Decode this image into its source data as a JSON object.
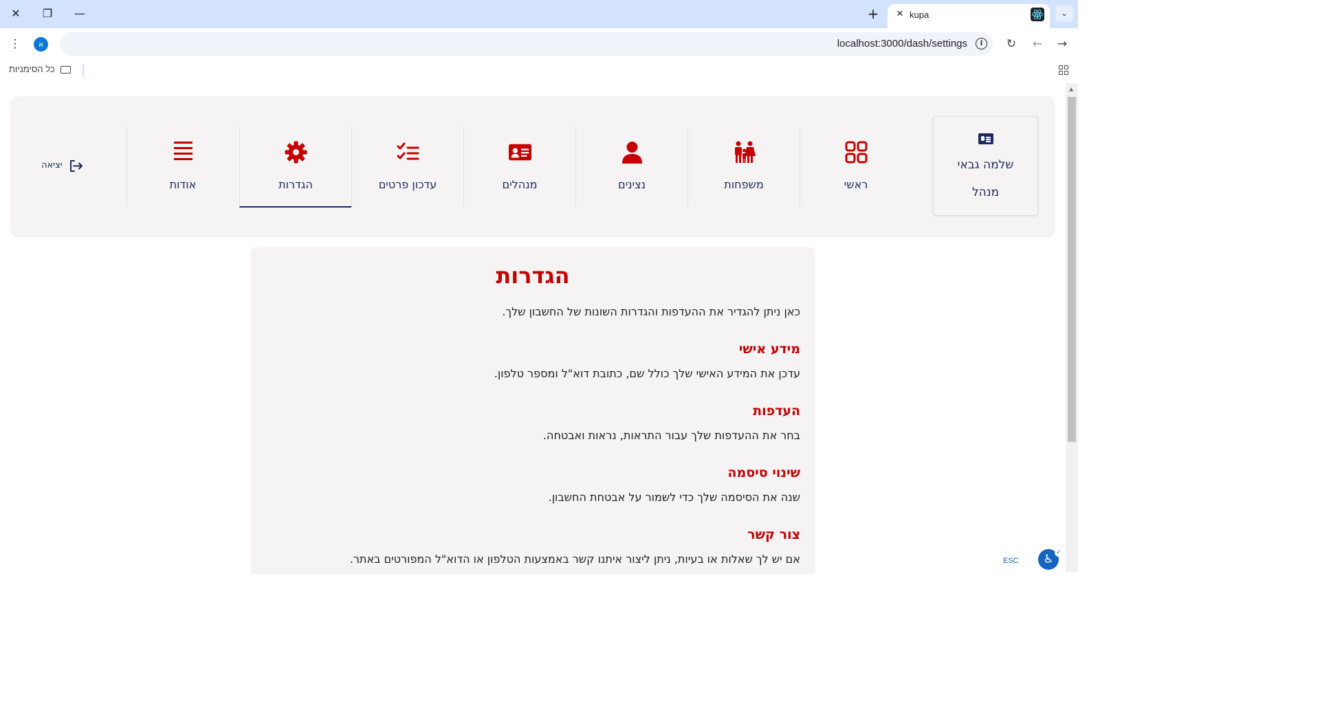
{
  "browser": {
    "tab_title": "kupa",
    "url": "localhost:3000/dash/settings",
    "profile_initial": "א",
    "bookmarks_all": "כל הסימניות",
    "new_tab": "+",
    "tab_list": "⌄"
  },
  "nav": {
    "user": {
      "name": "שלמה גבאי",
      "role": "מנהל"
    },
    "items": [
      {
        "label": "ראשי",
        "icon": "grid-icon"
      },
      {
        "label": "משפחות",
        "icon": "family-icon"
      },
      {
        "label": "נצינים",
        "icon": "person-icon"
      },
      {
        "label": "מנהלים",
        "icon": "id-card-icon"
      },
      {
        "label": "עדכון פרטים",
        "icon": "checklist-icon"
      },
      {
        "label": "הגדרות",
        "icon": "gear-icon",
        "active": true
      },
      {
        "label": "אודות",
        "icon": "menu-lines-icon"
      }
    ],
    "logout": "יציאה"
  },
  "colors": {
    "accent": "#c40000",
    "navy": "#1b2a5a",
    "panel": "#f5f3f4"
  },
  "content": {
    "title": "הגדרות",
    "intro": "כאן ניתן להגדיר את ההעדפות והגדרות השונות של החשבון שלך.",
    "sections": [
      {
        "title": "מידע אישי",
        "text": "עדכן את המידע האישי שלך כולל שם, כתובת דוא\"ל ומספר טלפון."
      },
      {
        "title": "העדפות",
        "text": "בחר את ההעדפות שלך עבור התראות, נראות ואבטחה."
      },
      {
        "title": "שינוי סיסמה",
        "text": "שנה את הסיסמה שלך כדי לשמור על אבטחת החשבון."
      },
      {
        "title": "צור קשר",
        "text": "אם יש לך שאלות או בעיות, ניתן ליצור איתנו קשר באמצעות הטלפון או הדוא\"ל המפורטים באתר."
      }
    ]
  },
  "widgets": {
    "esc": "ESC",
    "accessibility": "♿",
    "check": "✓"
  }
}
